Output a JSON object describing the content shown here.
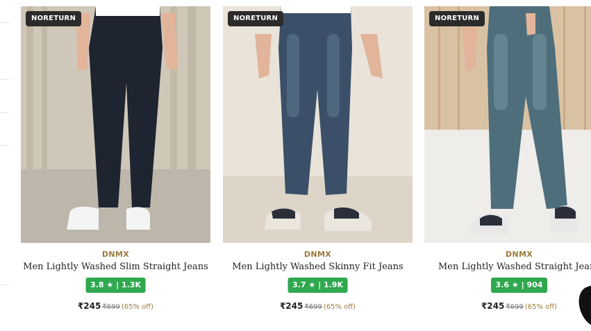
{
  "products": [
    {
      "badge": "NORETURN",
      "brand": "DNMX",
      "title": "Men Lightly Washed Slim Straight Jeans",
      "rating": "3.8",
      "star": "★",
      "separator": "|",
      "reviews": "1.3K",
      "price": "₹245",
      "mrp": "₹699",
      "discount": "(65% off)",
      "denim_color": "#1e2430",
      "bg_color": "#d8d2c6"
    },
    {
      "badge": "NORETURN",
      "brand": "DNMX",
      "title": "Men Lightly Washed Skinny Fit Jeans",
      "rating": "3.7",
      "star": "★",
      "separator": "|",
      "reviews": "1.9K",
      "price": "₹245",
      "mrp": "₹699",
      "discount": "(65% off)",
      "denim_color": "#3b5068",
      "bg_color": "#e4ddd2"
    },
    {
      "badge": "NORETURN",
      "brand": "DNMX",
      "title": "Men Lightly Washed Straight Jeans",
      "rating": "3.6",
      "star": "★",
      "separator": "|",
      "reviews": "904",
      "price": "₹245",
      "mrp": "₹699",
      "discount": "(65% off)",
      "denim_color": "#4e6e7c",
      "bg_color": "#d9c2a4"
    }
  ],
  "colors": {
    "brand_gold": "#9c7a3b",
    "rating_green": "#2fa84f",
    "badge_dark": "#2b2b2b"
  }
}
